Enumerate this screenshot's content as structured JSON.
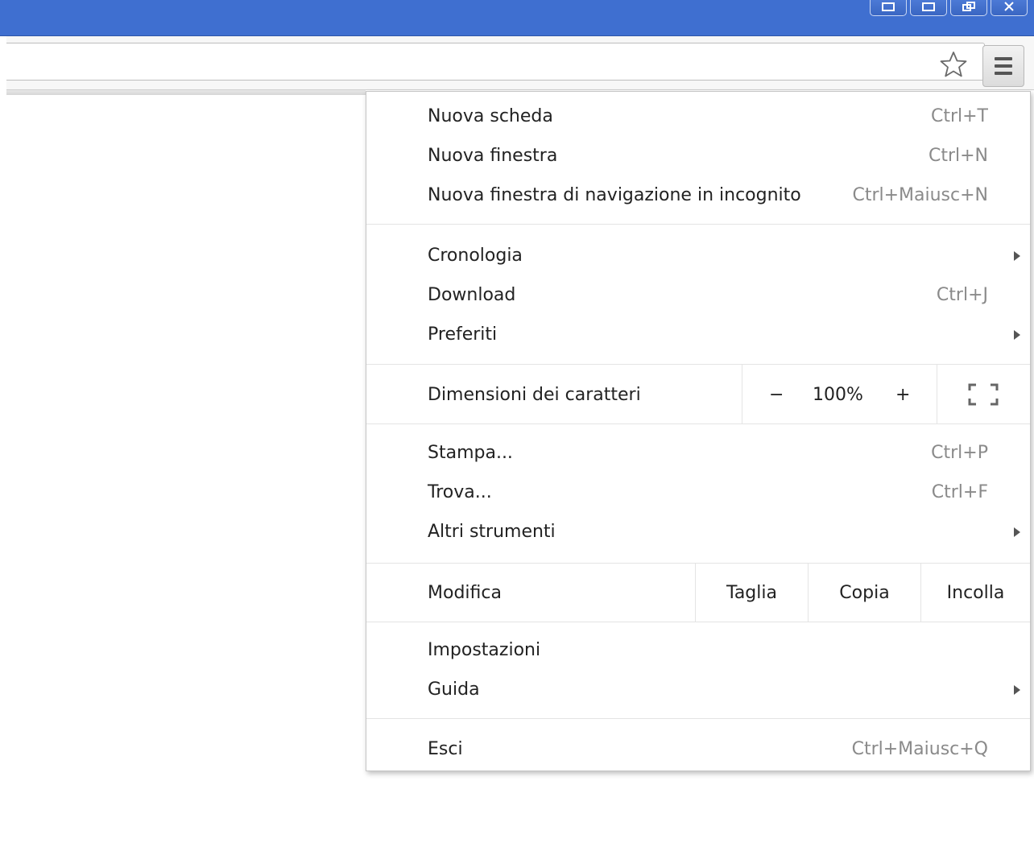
{
  "window": {
    "controls": [
      "minimize-icon",
      "maximize-icon",
      "restore-icon",
      "close-icon"
    ]
  },
  "toolbar": {
    "bookmark_icon": "star-icon",
    "menu_icon": "hamburger-menu-icon"
  },
  "menu": {
    "group1": [
      {
        "label": "Nuova scheda",
        "shortcut": "Ctrl+T"
      },
      {
        "label": "Nuova finestra",
        "shortcut": "Ctrl+N"
      },
      {
        "label": "Nuova finestra di navigazione in incognito",
        "shortcut": "Ctrl+Maiusc+N"
      }
    ],
    "group2": [
      {
        "label": "Cronologia",
        "submenu": true
      },
      {
        "label": "Download",
        "shortcut": "Ctrl+J"
      },
      {
        "label": "Preferiti",
        "submenu": true
      }
    ],
    "zoom": {
      "label": "Dimensioni dei caratteri",
      "minus": "−",
      "value": "100%",
      "plus": "+",
      "fullscreen_icon": "fullscreen-icon"
    },
    "group3": [
      {
        "label": "Stampa...",
        "shortcut": "Ctrl+P"
      },
      {
        "label": "Trova...",
        "shortcut": "Ctrl+F"
      },
      {
        "label": "Altri strumenti",
        "submenu": true
      }
    ],
    "edit": {
      "label": "Modifica",
      "cut": "Taglia",
      "copy": "Copia",
      "paste": "Incolla"
    },
    "group4": [
      {
        "label": "Impostazioni"
      },
      {
        "label": "Guida",
        "submenu": true
      }
    ],
    "exit": {
      "label": "Esci",
      "shortcut": "Ctrl+Maiusc+Q"
    }
  },
  "colors": {
    "titlebar": "#3f6fd0",
    "shortcut_text": "#8a8a8a"
  }
}
